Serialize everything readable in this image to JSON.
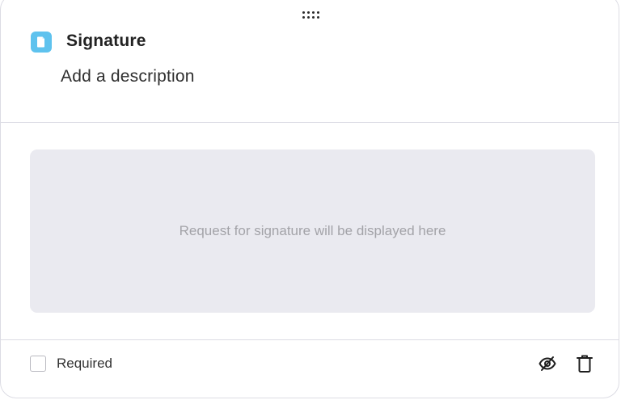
{
  "field": {
    "title": "Signature",
    "description": "Add a description",
    "icon": "document-icon",
    "icon_color": "#5ec2ee"
  },
  "body": {
    "placeholder": "Request for signature will be displayed here"
  },
  "footer": {
    "required_label": "Required",
    "required_checked": false,
    "visibility_icon": "eye-off-icon",
    "delete_icon": "trash-icon"
  },
  "colors": {
    "border": "#dcdce4",
    "placeholder_bg": "#eaeaf0",
    "placeholder_text": "#a3a3a8"
  }
}
